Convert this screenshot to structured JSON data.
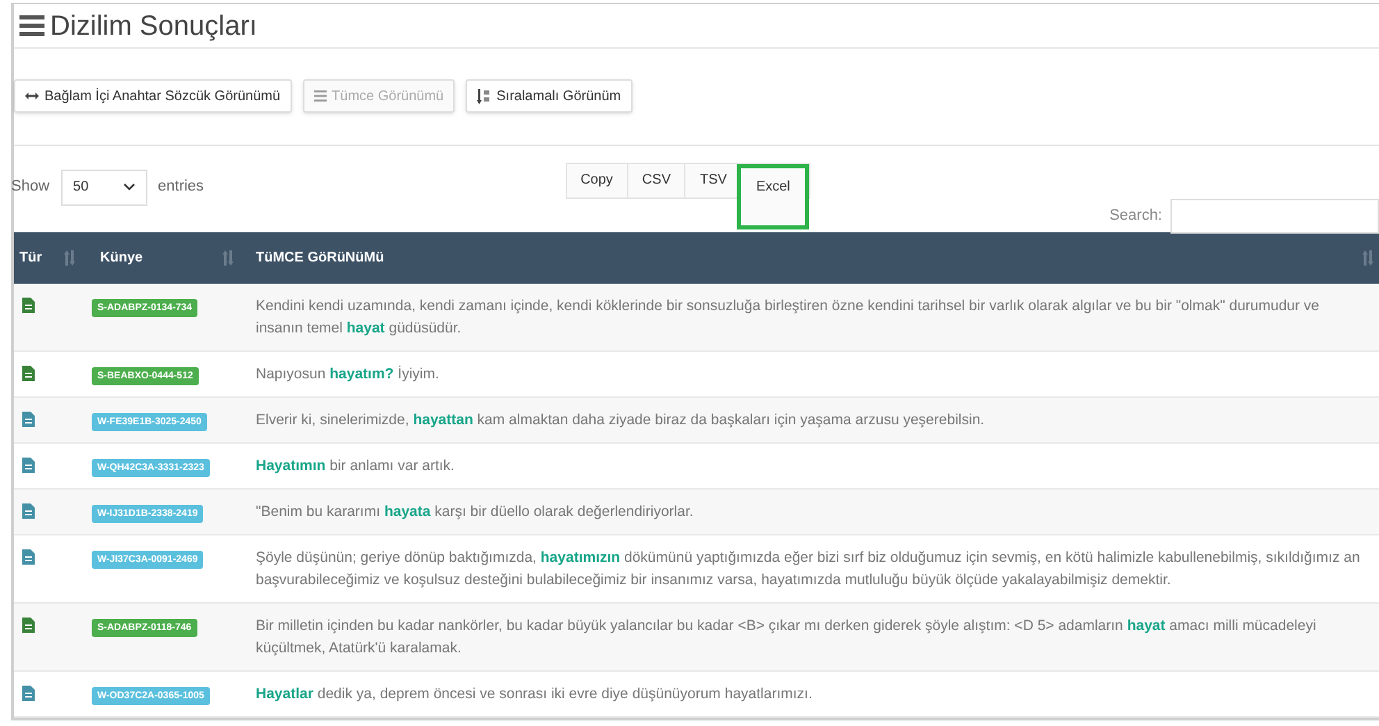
{
  "title": "Dizilim Sonuçları",
  "view_buttons": [
    {
      "label": "Bağlam İçi Anahtar Sözcük Görünümü",
      "kind": "arrows",
      "disabled": false
    },
    {
      "label": "Tümce Görünümü",
      "kind": "lines",
      "disabled": true
    },
    {
      "label": "Sıralamalı Görünüm",
      "kind": "sort",
      "disabled": false
    }
  ],
  "length": {
    "before": "Show",
    "value": "50",
    "after": "entries"
  },
  "export_buttons": [
    {
      "label": "Copy",
      "highlighted": false
    },
    {
      "label": "CSV",
      "highlighted": false
    },
    {
      "label": "TSV",
      "highlighted": false
    },
    {
      "label": "Excel",
      "highlighted": true
    }
  ],
  "search": {
    "label": "Search:"
  },
  "table": {
    "columns": [
      {
        "label": "Tür"
      },
      {
        "label": "Künye"
      },
      {
        "label": "TüMCE GöRüNüMü"
      }
    ],
    "rows": [
      {
        "color": "#4cae4c",
        "id": "S-ADABPZ-0134-734",
        "text": "Kendini kendi uzamında, kendi zamanı içinde, kendi köklerinde bir sonsuzluğa birleştiren özne kendini tarihsel bir varlık olarak algılar ve bu bir \"olmak\" durumudur ve insanın temel **hayat** güdüsüdür."
      },
      {
        "color": "#4cae4c",
        "id": "S-BEABXO-0444-512",
        "text": "Napıyosun **hayatım?** İyiyim."
      },
      {
        "color": "#5bc0de",
        "id": "W-FE39E1B-3025-2450",
        "text": "Elverir ki, sinelerimizde, **hayattan** kam almaktan daha ziyade biraz da başkaları için yaşama arzusu yeşerebilsin."
      },
      {
        "color": "#5bc0de",
        "id": "W-QH42C3A-3331-2323",
        "text": "**Hayatımın** bir anlamı var artık."
      },
      {
        "color": "#5bc0de",
        "id": "W-IJ31D1B-2338-2419",
        "text": "\"Benim bu kararımı **hayata** karşı bir düello olarak değerlendiriyorlar."
      },
      {
        "color": "#5bc0de",
        "id": "W-JI37C3A-0091-2469",
        "text": "Şöyle düşünün; geriye dönüp baktığımızda, **hayatımızın** dökümünü yaptığımızda eğer bizi sırf biz olduğumuz için sevmiş, en kötü halimizle kabullenebilmiş, sıkıldığımız an başvurabileceğimiz ve koşulsuz desteğini bulabileceğimiz bir insanımız varsa, hayatımızda mutluluğu büyük ölçüde yakalayabilmişiz demektir."
      },
      {
        "color": "#4cae4c",
        "id": "S-ADABPZ-0118-746",
        "text": "Bir milletin içinden bu kadar nankörler, bu kadar büyük yalancılar bu kadar <B> çıkar mı derken giderek şöyle alıştım: <D 5> adamların **hayat** amacı milli mücadeleyi küçültmek, Atatürk'ü karalamak."
      },
      {
        "color": "#5bc0de",
        "id": "W-OD37C2A-0365-1005",
        "text": "**Hayatlar** dedik ya, deprem öncesi ve sonrası iki evre diye düşünüyorum hayatlarımızı."
      }
    ]
  }
}
